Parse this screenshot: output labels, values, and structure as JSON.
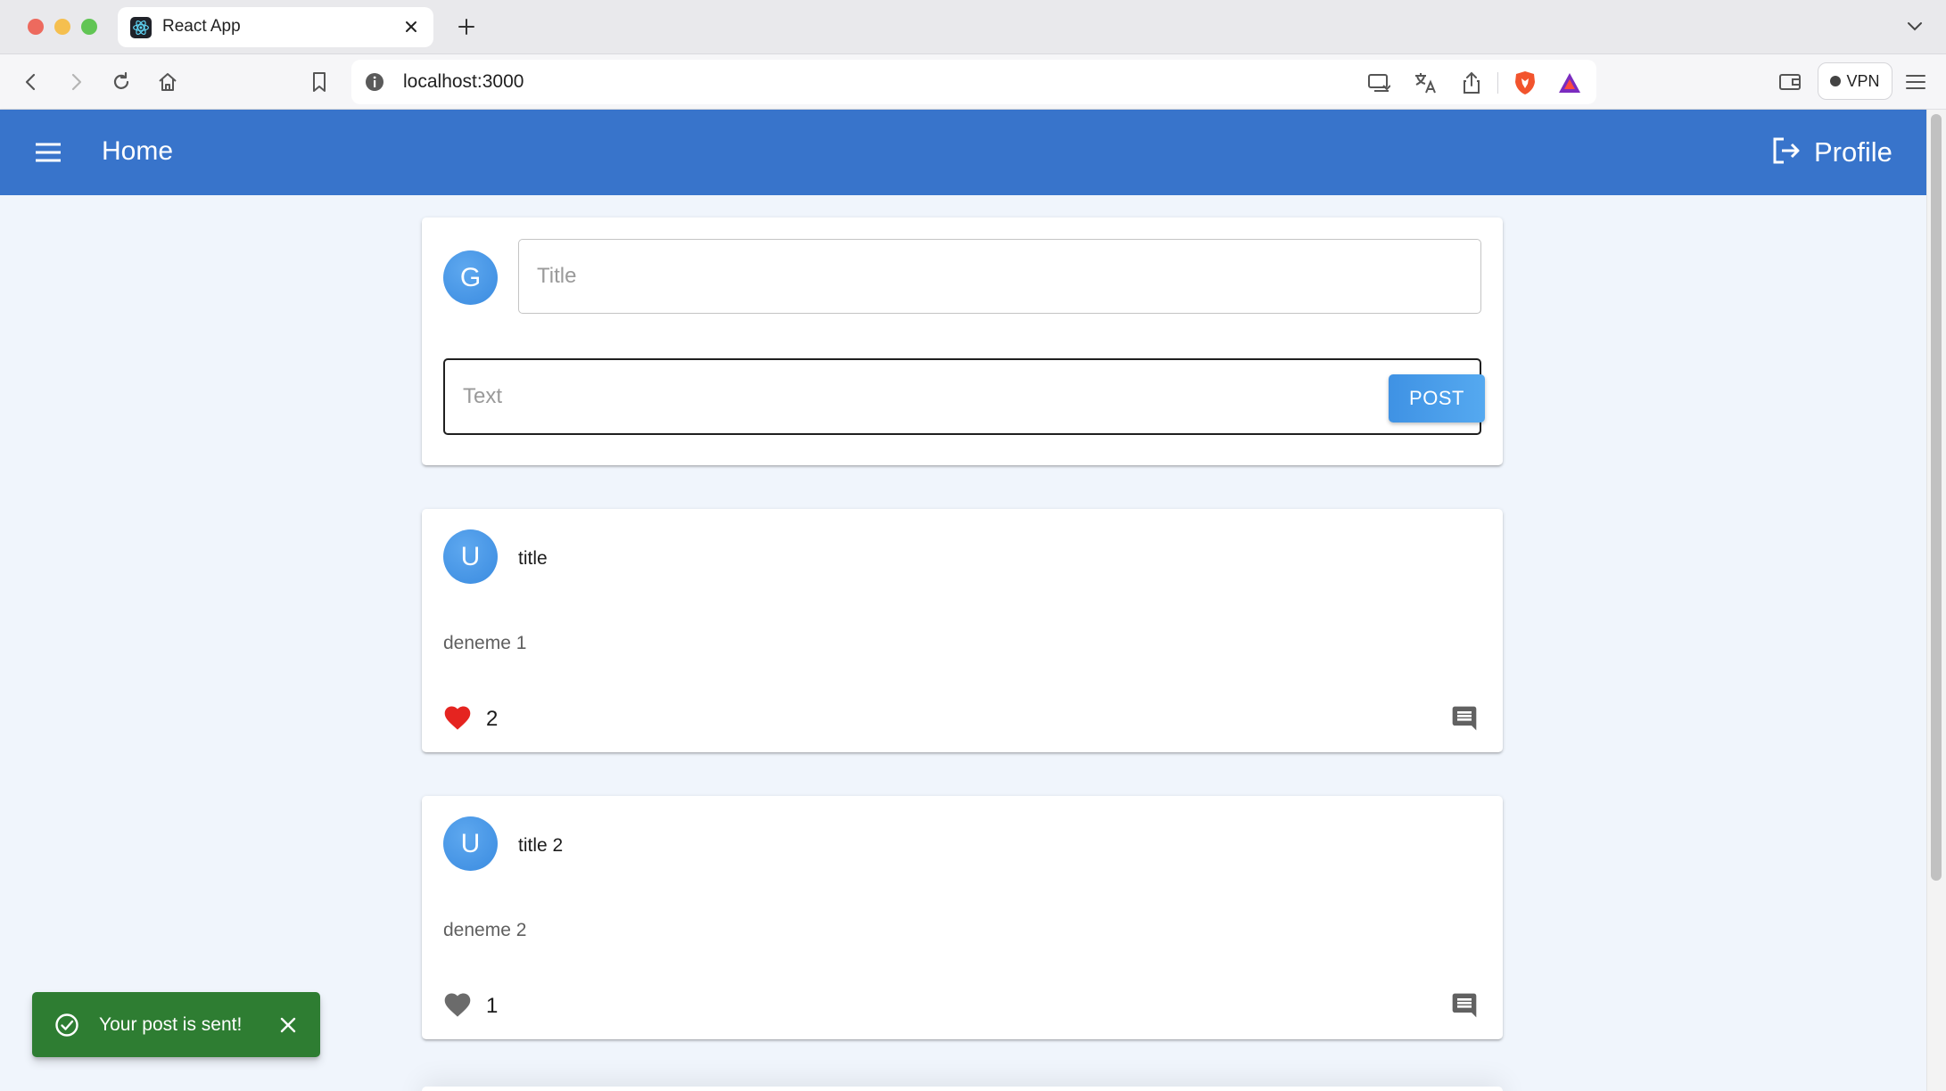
{
  "browser": {
    "tab_title": "React App",
    "url": "localhost:3000",
    "vpn_label": "VPN",
    "icons": [
      "react-favicon",
      "close-icon",
      "plus-icon",
      "chevron-down-icon",
      "back-icon",
      "forward-icon",
      "reload-icon",
      "home-icon",
      "bookmark-icon",
      "info-icon",
      "cast-icon",
      "translate-icon",
      "share-icon",
      "brave-shield-icon",
      "brave-rewards-icon",
      "wallet-icon",
      "menu-icon"
    ]
  },
  "appbar": {
    "title": "Home",
    "profile_label": "Profile",
    "color": "#3874cb"
  },
  "composer": {
    "avatar_letter": "G",
    "title_placeholder": "Title",
    "text_placeholder": "Text",
    "post_label": "POST"
  },
  "posts": [
    {
      "avatar_letter": "U",
      "title": "title",
      "text": "deneme 1",
      "likes": "2",
      "liked": true
    },
    {
      "avatar_letter": "U",
      "title": "title 2",
      "text": "deneme 2",
      "likes": "1",
      "liked": false
    }
  ],
  "snackbar": {
    "message": "Your post is sent!",
    "color": "#2e7d32"
  }
}
